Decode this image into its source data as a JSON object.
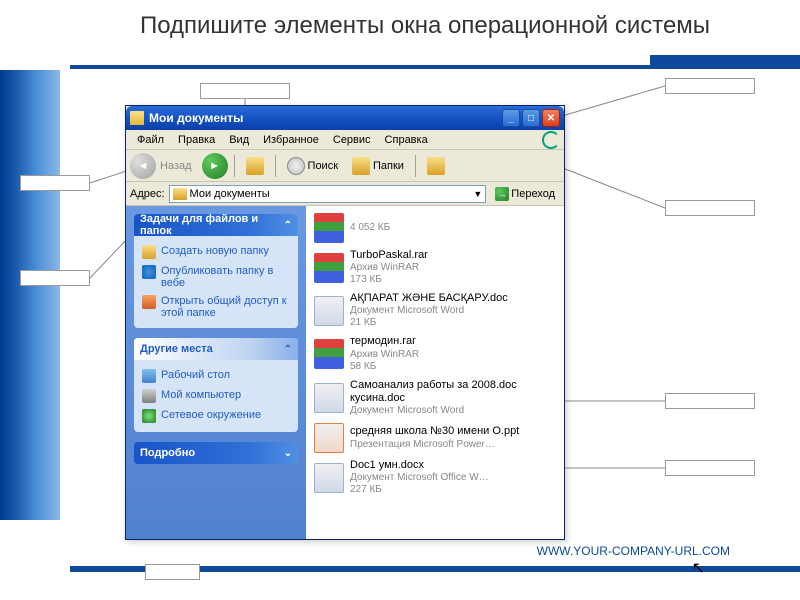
{
  "slide": {
    "title": "Подпишите элементы окна операционной системы",
    "footer": "WWW.YOUR-COMPANY-URL.COM"
  },
  "window": {
    "title": "Мои документы",
    "controls": {
      "min": "_",
      "max": "□",
      "close": "✕"
    }
  },
  "menu": {
    "file": "Файл",
    "edit": "Правка",
    "view": "Вид",
    "favorites": "Избранное",
    "tools": "Сервис",
    "help": "Справка"
  },
  "toolbar": {
    "back": "Назад",
    "search": "Поиск",
    "folders": "Папки"
  },
  "address": {
    "label": "Адрес:",
    "value": "Мои документы",
    "go": "Переход"
  },
  "taskpane": {
    "tasks": {
      "header": "Задачи для файлов и папок",
      "items": [
        "Создать новую папку",
        "Опубликовать папку в вебе",
        "Открыть общий доступ к этой папке"
      ]
    },
    "places": {
      "header": "Другие места",
      "items": [
        "Рабочий стол",
        "Мой компьютер",
        "Сетевое окружение"
      ]
    },
    "details": {
      "header": "Подробно"
    }
  },
  "files": [
    {
      "name": "",
      "meta1": "",
      "meta2": "4 052 КБ",
      "icon": "fi-rar"
    },
    {
      "name": "TurboPaskal.rar",
      "meta1": "Архив WinRAR",
      "meta2": "173 КБ",
      "icon": "fi-rar"
    },
    {
      "name": "АҚПАРАТ ЖӘНЕ БАСҚАРУ.doc",
      "meta1": "Документ Microsoft Word",
      "meta2": "21 КБ",
      "icon": "fi-doc"
    },
    {
      "name": "термодин.rar",
      "meta1": "Архив WinRAR",
      "meta2": "58 КБ",
      "icon": "fi-rar"
    },
    {
      "name": "Самоанализ работы за 2008.doc кусина.doc",
      "meta1": "Документ Microsoft Word",
      "meta2": "",
      "icon": "fi-doc"
    },
    {
      "name": "средняя школа №30 имени О.ppt",
      "meta1": "Презентация Microsoft Power…",
      "meta2": "",
      "icon": "fi-ppt"
    },
    {
      "name": "Doc1 умн.docx",
      "meta1": "Документ Microsoft Office W…",
      "meta2": "227 КБ",
      "icon": "fi-docx"
    }
  ]
}
